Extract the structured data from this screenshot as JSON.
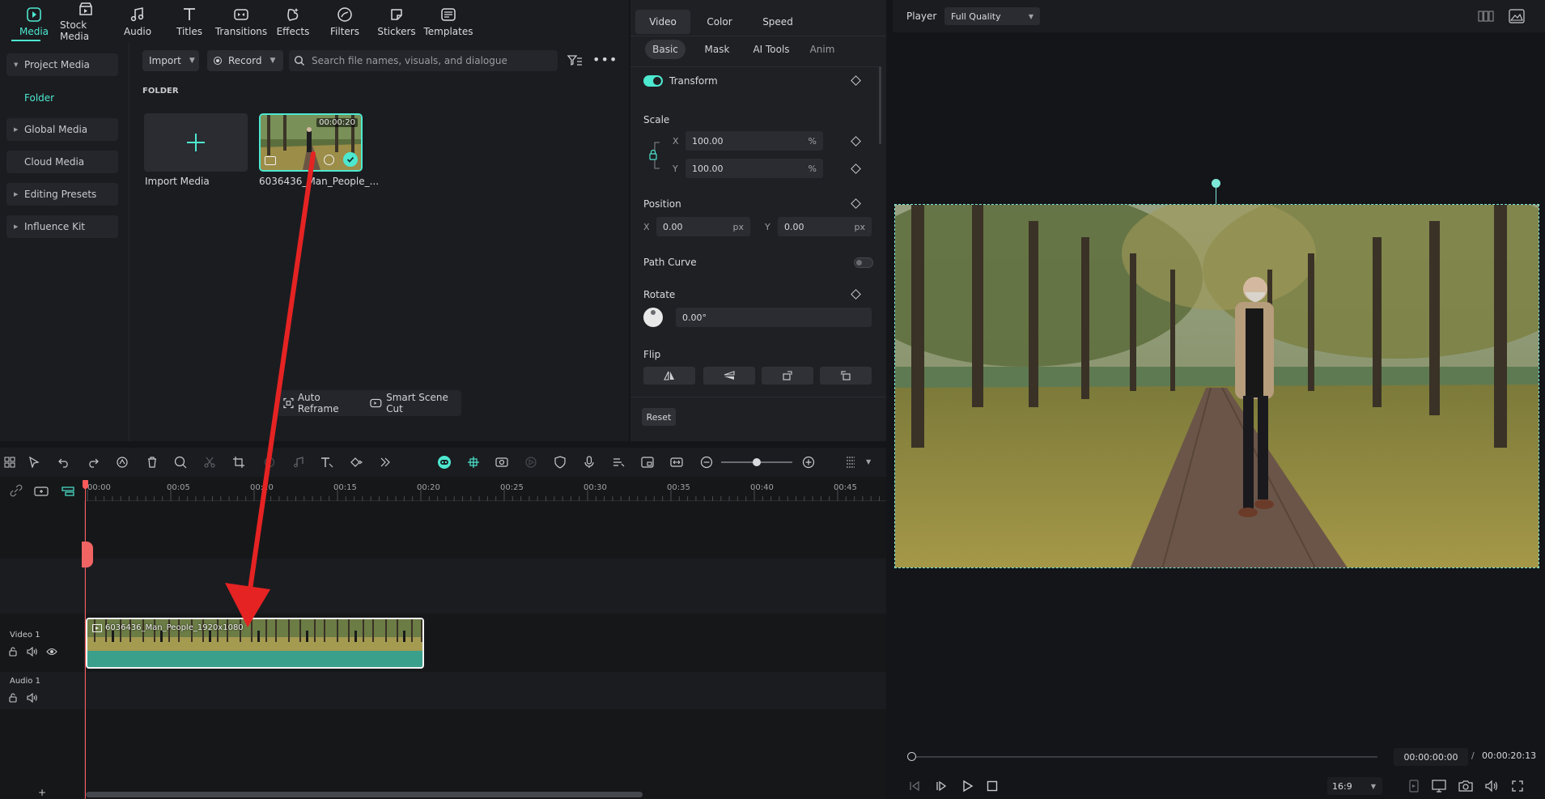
{
  "toolbar": {
    "items": [
      {
        "label": "Media",
        "icon": "media-icon"
      },
      {
        "label": "Stock Media",
        "icon": "stock-media-icon"
      },
      {
        "label": "Audio",
        "icon": "audio-icon"
      },
      {
        "label": "Titles",
        "icon": "titles-icon"
      },
      {
        "label": "Transitions",
        "icon": "transitions-icon"
      },
      {
        "label": "Effects",
        "icon": "effects-icon"
      },
      {
        "label": "Filters",
        "icon": "filters-icon"
      },
      {
        "label": "Stickers",
        "icon": "stickers-icon"
      },
      {
        "label": "Templates",
        "icon": "templates-icon"
      }
    ],
    "active": "Media"
  },
  "sidebar": {
    "project_media": "Project Media",
    "folder": "Folder",
    "global_media": "Global Media",
    "cloud_media": "Cloud Media",
    "editing_presets": "Editing Presets",
    "influence_kit": "Influence Kit"
  },
  "media": {
    "import_label": "Import",
    "record_label": "Record",
    "search_placeholder": "Search file names, visuals, and dialogue",
    "folder_header": "FOLDER",
    "import_media_label": "Import Media",
    "clip_name": "6036436_Man_People_...",
    "clip_duration": "00:00:20",
    "auto_reframe": "Auto Reframe",
    "smart_scene_cut": "Smart Scene Cut"
  },
  "properties": {
    "tabs": [
      "Video",
      "Color",
      "Speed"
    ],
    "active_tab": "Video",
    "subtabs": [
      "Basic",
      "Mask",
      "AI Tools",
      "Anim"
    ],
    "active_subtab": "Basic",
    "transform_label": "Transform",
    "scale_label": "Scale",
    "scale_x_axis": "X",
    "scale_y_axis": "Y",
    "scale_x": "100.00",
    "scale_y": "100.00",
    "percent_unit": "%",
    "position_label": "Position",
    "pos_x_axis": "X",
    "pos_y_axis": "Y",
    "pos_x": "0.00",
    "pos_y": "0.00",
    "px_unit": "px",
    "path_curve_label": "Path Curve",
    "rotate_label": "Rotate",
    "rotate_value": "0.00°",
    "flip_label": "Flip",
    "reset_label": "Reset"
  },
  "player": {
    "label": "Player",
    "quality": "Full Quality",
    "current_time": "00:00:00:00",
    "separator": "/",
    "total_time": "00:00:20:13",
    "aspect": "16:9"
  },
  "timeline": {
    "ruler": [
      "00:00",
      "00:05",
      "00:10",
      "00:15",
      "00:20",
      "00:25",
      "00:30",
      "00:35",
      "00:40",
      "00:45"
    ],
    "video_track": "Video 1",
    "audio_track": "Audio 1",
    "clip_label": "6036436_Man_People_1920x1080"
  },
  "colors": {
    "accent": "#4de8d0",
    "clip": "#3aa08c",
    "playhead": "#ff5a5a",
    "arrow": "#e52323"
  }
}
